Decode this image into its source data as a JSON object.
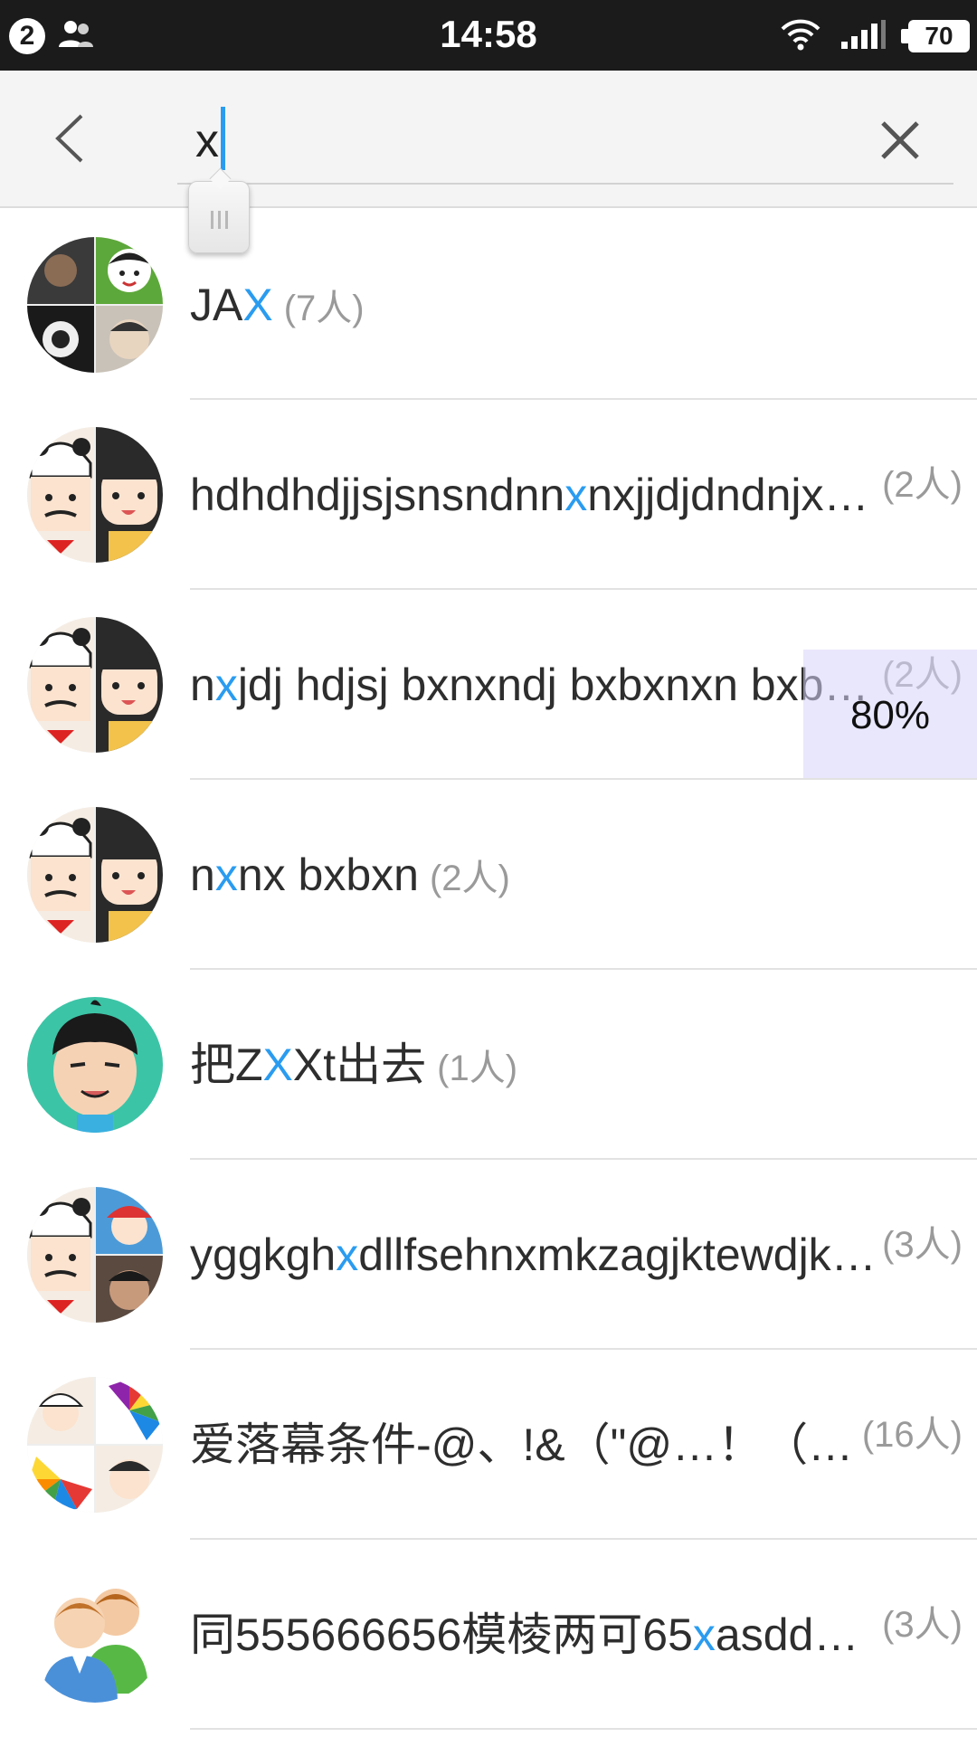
{
  "status_bar": {
    "notification_count": "2",
    "time": "14:58",
    "battery": "70",
    "icons": [
      "contacts-icon",
      "wifi-icon",
      "signal-icon",
      "battery-icon"
    ]
  },
  "search": {
    "query": "x",
    "back_icon": "chevron-left-icon",
    "clear_icon": "close-icon"
  },
  "highlight_color": "#2a9cf0",
  "results": [
    {
      "name_pre": "JA",
      "name_hl": "X",
      "name_post": "",
      "count": "(7人)",
      "count_pos": "inline",
      "avatar": "four-photo"
    },
    {
      "name_pre": "hdhdhdjjsjsnsndnn",
      "name_hl": "x",
      "name_post": "nxjjdjdndnjx…",
      "count": "(2人)",
      "count_pos": "right",
      "avatar": "two-cartoon"
    },
    {
      "name_pre": "n",
      "name_hl": "x",
      "name_post": "jdj hdjsj bxnxndj bxbxnxn bxb…",
      "count": "(2人)",
      "count_pos": "right",
      "avatar": "two-cartoon"
    },
    {
      "name_pre": "n",
      "name_hl": "x",
      "name_post": "nx bxbxn",
      "count": "(2人)",
      "count_pos": "inline",
      "avatar": "two-cartoon"
    },
    {
      "name_pre": "把Z",
      "name_hl": "X",
      "name_post": "Xt出去",
      "count": "(1人)",
      "count_pos": "inline",
      "avatar": "single-cartoon"
    },
    {
      "name_pre": "yggkgh",
      "name_hl": "x",
      "name_post": "dllfsehnxmkzagjktewdjk…",
      "count": "(3人)",
      "count_pos": "right",
      "avatar": "three-mixed"
    },
    {
      "name_pre": "爱落幕条件-@、!&（\"@…！（…",
      "name_hl": "",
      "name_post": "",
      "count": "(16人)",
      "count_pos": "right",
      "avatar": "four-colorful"
    },
    {
      "name_pre": "同555666656模棱两可65",
      "name_hl": "x",
      "name_post": "asdd…",
      "count": "(3人)",
      "count_pos": "right",
      "avatar": "default-group"
    }
  ],
  "progress": {
    "label": "80%",
    "value": 0.8
  }
}
